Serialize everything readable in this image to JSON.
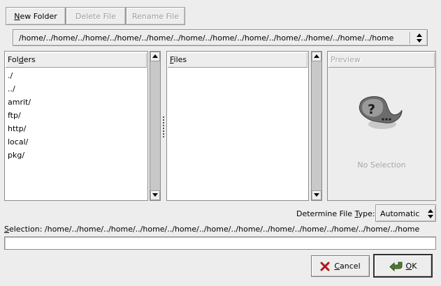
{
  "toolbar": {
    "new_folder": "New Folder",
    "delete_file": "Delete File",
    "rename_file": "Rename File"
  },
  "path_combo": {
    "value": "/home/../home/../home/../home/../home/../home/../home/../home/../home/../home/../home/../home"
  },
  "folders": {
    "header": "Folders",
    "items": [
      "./",
      "../",
      "amrit/",
      "ftp/",
      "http/",
      "local/",
      "pkg/"
    ]
  },
  "files": {
    "header": "Files"
  },
  "preview": {
    "header": "Preview",
    "empty_text": "No Selection",
    "icon": "unknown-file-question-icon"
  },
  "file_type": {
    "label": "Determine File Type:",
    "value": "Automatic"
  },
  "selection": {
    "label_text": "Selection: /home/../home/../home/../home/../home/../home/../home/../home/../home/../home/../home/../home",
    "input_value": ""
  },
  "actions": {
    "cancel": "Cancel",
    "ok": "OK"
  },
  "colors": {
    "cancel_icon": "#b01818",
    "ok_icon": "#4f7a2c",
    "window_bg": "#ededed"
  }
}
